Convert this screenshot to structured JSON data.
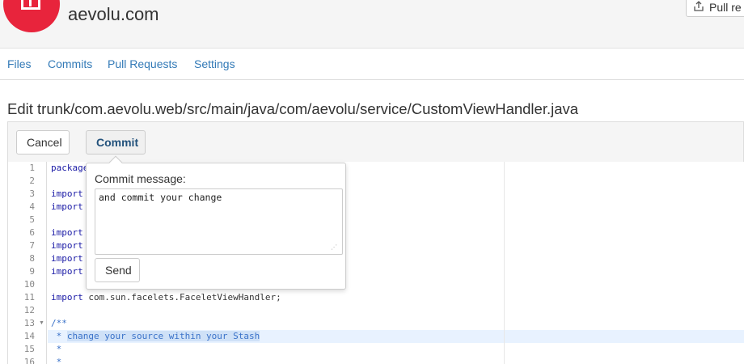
{
  "header": {
    "site_title": "aevolu.com",
    "pull_button_label": "Pull re"
  },
  "nav": {
    "items": [
      {
        "label": "Files"
      },
      {
        "label": "Commits"
      },
      {
        "label": "Pull Requests"
      },
      {
        "label": "Settings"
      }
    ]
  },
  "edit": {
    "title": "Edit trunk/com.aevolu.web/src/main/java/com/aevolu/service/CustomViewHandler.java"
  },
  "toolbar": {
    "cancel_label": "Cancel",
    "commit_label": "Commit"
  },
  "editor": {
    "line_numbers": [
      "1",
      "2",
      "3",
      "4",
      "5",
      "6",
      "7",
      "8",
      "9",
      "10",
      "11",
      "12",
      "13",
      "14",
      "15",
      "16"
    ],
    "lines": [
      {
        "kw": "package",
        "rest": ""
      },
      {
        "kw": "",
        "rest": ""
      },
      {
        "kw": "import",
        "rest": ""
      },
      {
        "kw": "import",
        "rest": ""
      },
      {
        "kw": "",
        "rest": ""
      },
      {
        "kw": "import",
        "rest": ""
      },
      {
        "kw": "import",
        "rest": ""
      },
      {
        "kw": "import",
        "rest": ""
      },
      {
        "kw": "import",
        "rest": ""
      },
      {
        "kw": "",
        "rest": ""
      },
      {
        "kw": "import",
        "rest": " com.sun.facelets.FaceletViewHandler;"
      },
      {
        "kw": "",
        "rest": ""
      },
      {
        "kw": "",
        "rest": "/**"
      },
      {
        "kw": "",
        "rest": " * ",
        "selected": "change your source within your Stash"
      },
      {
        "kw": "",
        "rest": " *"
      },
      {
        "kw": "",
        "rest": " *"
      }
    ]
  },
  "popover": {
    "label": "Commit message:",
    "message_value": "and commit your change",
    "send_label": "Send"
  },
  "colors": {
    "brand": "#e8243c",
    "link": "#337ab7",
    "selection": "#cfe1f7"
  },
  "icons": {
    "logo": "box-logo-icon",
    "pull": "upload-icon",
    "fold": "fold-arrow-icon"
  }
}
